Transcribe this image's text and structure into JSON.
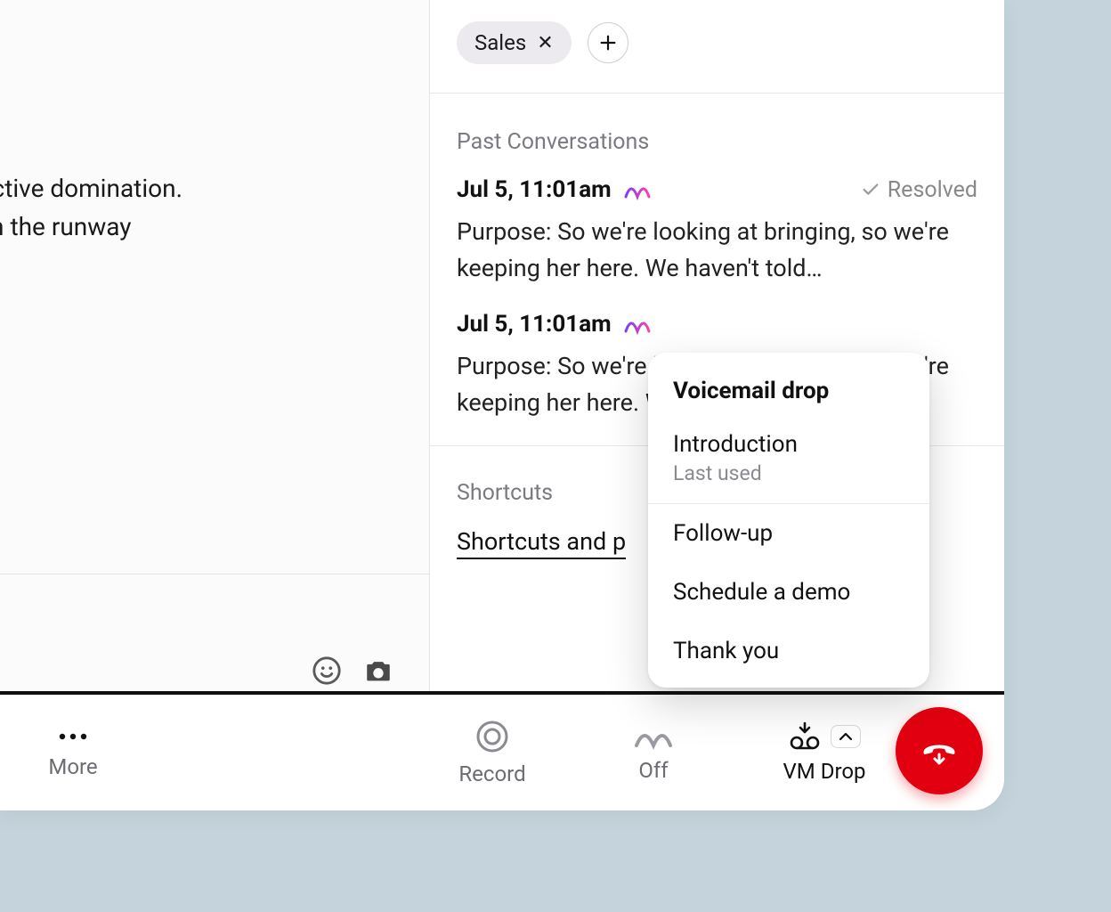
{
  "tags": {
    "items": [
      "Sales"
    ]
  },
  "left_text": {
    "line1": "s to ensure proactive domination.",
    "line2": "jeneration X is on the runway"
  },
  "sections": {
    "past_conversations_title": "Past Conversations",
    "shortcuts_title": "Shortcuts",
    "shortcuts_link": "Shortcuts and p"
  },
  "convos": [
    {
      "date": "Jul 5, 11:01am",
      "resolved_label": "Resolved",
      "body": "Purpose: So we're looking at bringing, so we're keeping her here. We haven't told…"
    },
    {
      "date": "Jul 5, 11:01am",
      "body": "Purpose: So we're looking at bringing, so we're keeping her here. We haven't told…"
    }
  ],
  "popup": {
    "title": "Voicemail drop",
    "items": [
      {
        "label": "Introduction",
        "sub": "Last used"
      },
      {
        "label": "Follow-up"
      },
      {
        "label": "Schedule a demo"
      },
      {
        "label": "Thank you"
      }
    ]
  },
  "bottom_bar": {
    "more": "More",
    "record": "Record",
    "off": "Off",
    "vm_drop": "VM Drop"
  }
}
